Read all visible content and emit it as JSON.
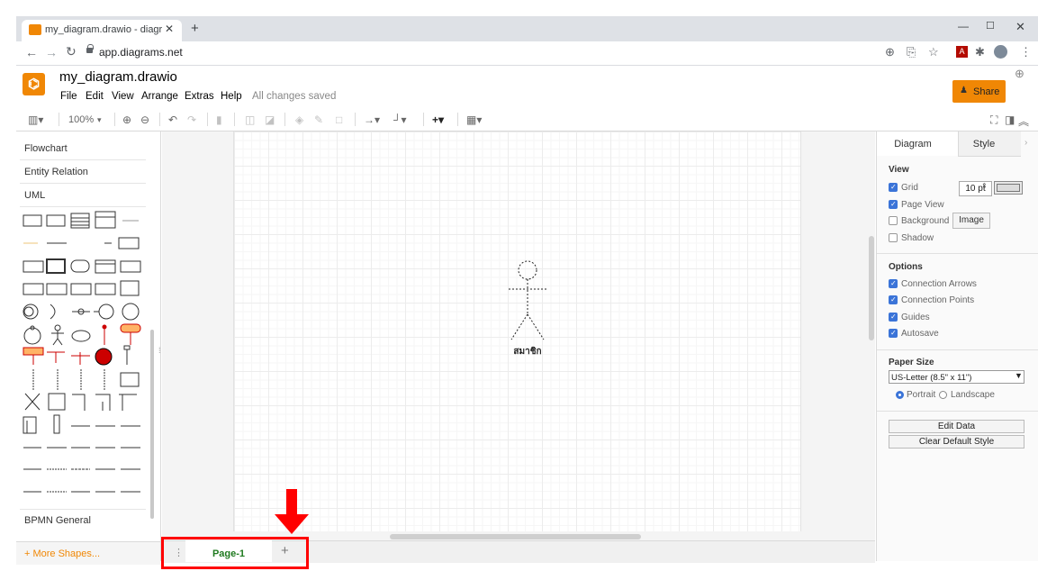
{
  "browser": {
    "tab_title": "my_diagram.drawio - diagrams.n",
    "tab_close": "✕",
    "new_tab": "+",
    "url": "app.diagrams.net"
  },
  "app": {
    "file_title": "my_diagram.drawio",
    "menu": [
      "File",
      "Edit",
      "View",
      "Arrange",
      "Extras",
      "Help"
    ],
    "save_status": "All changes saved",
    "share_label": "Share",
    "accent_color": "#f08705"
  },
  "toolbar": {
    "zoom": "100%"
  },
  "sidebar": {
    "sections_top": [
      "Flowchart",
      "Entity Relation",
      "UML"
    ],
    "section_bottom": "BPMN General",
    "more_shapes": "+ More Shapes..."
  },
  "canvas": {
    "actor_label": "สมาชิก"
  },
  "pages": {
    "current_page": "Page-1",
    "add_page": "+",
    "highlight_color": "#ff0000"
  },
  "format_panel": {
    "tabs": [
      "Diagram",
      "Style"
    ],
    "view_heading": "View",
    "grid_label": "Grid",
    "grid_size": "10 pt",
    "page_view_label": "Page View",
    "background_label": "Background",
    "image_button": "Image",
    "shadow_label": "Shadow",
    "options_heading": "Options",
    "connection_arrows_label": "Connection Arrows",
    "connection_points_label": "Connection Points",
    "guides_label": "Guides",
    "autosave_label": "Autosave",
    "paper_size_heading": "Paper Size",
    "paper_size_value": "US-Letter (8.5\" x 11\")",
    "portrait_label": "Portrait",
    "landscape_label": "Landscape",
    "edit_data_button": "Edit Data",
    "clear_style_button": "Clear Default Style"
  }
}
